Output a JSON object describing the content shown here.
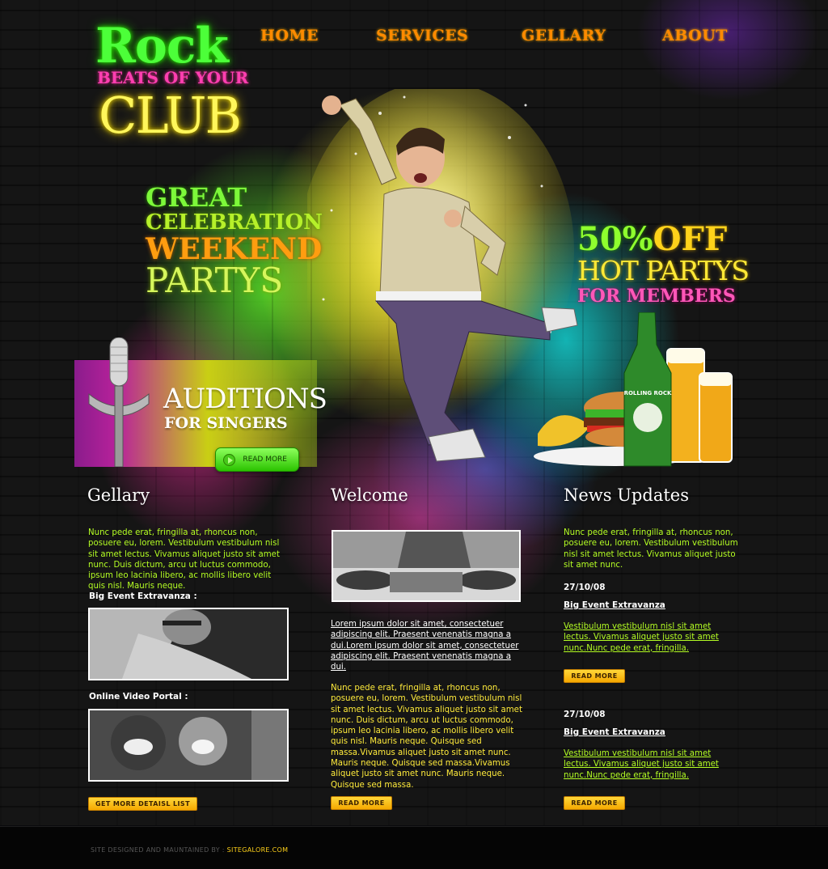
{
  "logo": {
    "line1": "Rock",
    "line2": "BEATS OF YOUR",
    "line3": "CLUB"
  },
  "nav": {
    "items": [
      "HOME",
      "SERVICES",
      "GELLARY",
      "ABOUT"
    ]
  },
  "hero": {
    "left_promo": [
      "GREAT",
      "CELEBRATION",
      "WEEKEND",
      "PARTYS"
    ],
    "right_promo": {
      "line1_pct": "50%",
      "line1_off": "OFF",
      "line2": "HOT PARTYS",
      "line3": "FOR MEMBERS"
    },
    "beer_label": "ROLLING ROCK",
    "audition": {
      "title": "AUDITIONS",
      "subtitle": "FOR SINGERS",
      "button": "READ MORE"
    }
  },
  "gellary": {
    "title": "Gellary",
    "text": "Nunc pede erat, fringilla at, rhoncus non, posuere eu, lorem. Vestibulum vestibulum nisl sit amet lectus. Vivamus aliquet justo sit amet nunc. Duis dictum, arcu ut luctus commodo, ipsum leo lacinia libero, ac mollis libero velit quis nisl. Mauris neque.",
    "caption1": "Big Event Extravanza :",
    "caption2": "Online Video Portal :",
    "button": "GET MORE DETAISL LIST"
  },
  "welcome": {
    "title": "Welcome",
    "link_text": "Lorem ipsum dolor sit amet, consectetuer adipiscing elit. Praesent venenatis magna a dui.Lorem ipsum dolor sit amet, consectetuer adipiscing elit. Praesent venenatis magna a dui.",
    "text": "Nunc pede erat, fringilla at, rhoncus non, posuere eu, lorem. Vestibulum vestibulum nisl sit amet lectus. Vivamus aliquet justo sit amet nunc. Duis dictum, arcu ut luctus commodo, ipsum leo lacinia libero, ac mollis libero velit quis nisl. Mauris neque. Quisque sed massa.Vivamus aliquet justo sit amet nunc.  Mauris neque. Quisque sed massa.Vivamus aliquet justo sit amet nunc. Mauris neque. Quisque sed massa.",
    "button": "READ MORE"
  },
  "news": {
    "title": "News Updates",
    "intro": "Nunc pede erat, fringilla at, rhoncus non, posuere eu, lorem. Vestibulum vestibulum nisl sit amet lectus. Vivamus aliquet justo sit amet nunc.",
    "items": [
      {
        "date": "27/10/08",
        "headline": "Big Event Extravanza",
        "text": "Vestibulum vestibulum nisl sit amet lectus. Vivamus aliquet justo sit amet nunc.Nunc pede erat, fringilla.",
        "button": "READ MORE"
      },
      {
        "date": "27/10/08",
        "headline": "Big Event Extravanza",
        "text": "Vestibulum vestibulum nisl sit amet lectus. Vivamus aliquet justo sit amet nunc.Nunc pede erat, fringilla.",
        "button": "READ MORE"
      }
    ]
  },
  "footer": {
    "credit": "SITE DESIGNED AND MAUNTAINED BY : ",
    "site": "SITEGALORE.COM"
  },
  "colors": {
    "nav": "#ff8a00",
    "accent_yellow": "#ffe936",
    "accent_green": "#b5ff24",
    "accent_pink": "#ff3fb1",
    "button_yellow": "#ffd739",
    "footer_bg": "#050505"
  }
}
